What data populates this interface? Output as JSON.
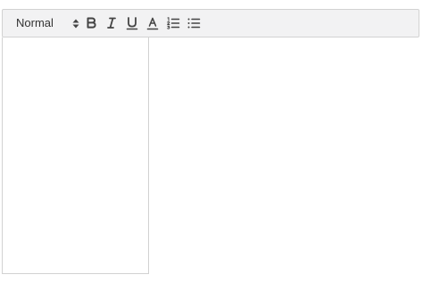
{
  "toolbar": {
    "format_select": {
      "selected": "Normal"
    },
    "buttons": [
      {
        "name": "bold",
        "icon": "bold-icon"
      },
      {
        "name": "italic",
        "icon": "italic-icon"
      },
      {
        "name": "underline",
        "icon": "underline-icon"
      },
      {
        "name": "text-color",
        "icon": "text-color-icon"
      },
      {
        "name": "ordered-list",
        "icon": "ordered-list-icon"
      },
      {
        "name": "bullet-list",
        "icon": "bullet-list-icon"
      }
    ],
    "colors": {
      "background": "#f2f2f3",
      "border": "#d2d2d2",
      "icon": "#444444"
    }
  },
  "editor": {
    "content": ""
  }
}
